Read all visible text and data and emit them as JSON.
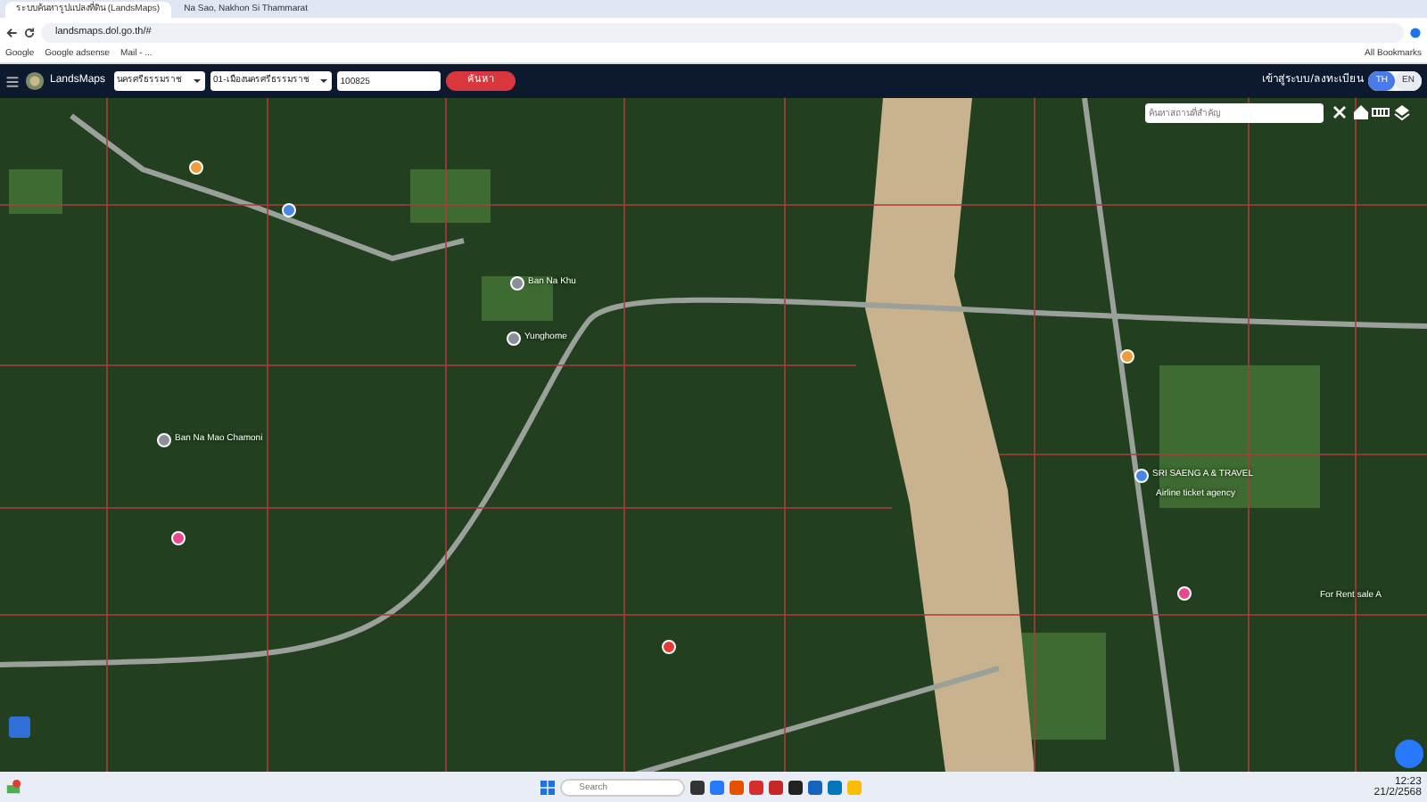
{
  "browser": {
    "tabs": [
      {
        "title": "ระบบค้นหารูปแปลงที่ดิน (LandsMaps)",
        "selected": true
      },
      {
        "title": "Na Sao, Nakhon Si Thammarat",
        "selected": false
      }
    ],
    "url": "landsmaps.dol.go.th/#",
    "bookmarks": [
      "Google",
      "Google adsense",
      "Mail - ...",
      "All Bookmarks"
    ]
  },
  "app": {
    "logo": "LandsMaps",
    "province": "นครศรีธรรมราช",
    "district": "01-เมืองนครศรีธรรมราช",
    "parcel_number": "100825",
    "search_button": "ค้นหา",
    "login": "เข้าสู่ระบบ/ลงทะเบียน",
    "languages": [
      {
        "label": "TH",
        "selected": true
      },
      {
        "label": "EN",
        "selected": false
      }
    ]
  },
  "map": {
    "place_search": {
      "placeholder": "ค้นหาสถานที่สำคัญ"
    },
    "pins": [
      {
        "label": "Ban Na Khu",
        "color": "#8a8f99"
      },
      {
        "label": "Yunghome",
        "color": "#8a8f99"
      },
      {
        "label": "Ban Na Mao Chamoni",
        "color": "#8a8f99"
      },
      {
        "label": "SRI SAENG A & TRAVEL",
        "color": "#4a86e8"
      },
      {
        "label": "Airline ticket agency"
      },
      {
        "label": "For Rent sale A"
      },
      {
        "color": "#f29b38"
      },
      {
        "color": "#4a86e8"
      },
      {
        "color": "#e8488f"
      },
      {
        "color": "#e8488f"
      },
      {
        "color": "#f29b38"
      },
      {
        "color": "#e53935"
      }
    ]
  },
  "taskbar": {
    "search": {
      "placeholder": "Search"
    },
    "time": "12:23",
    "date": "21/2/2568"
  }
}
